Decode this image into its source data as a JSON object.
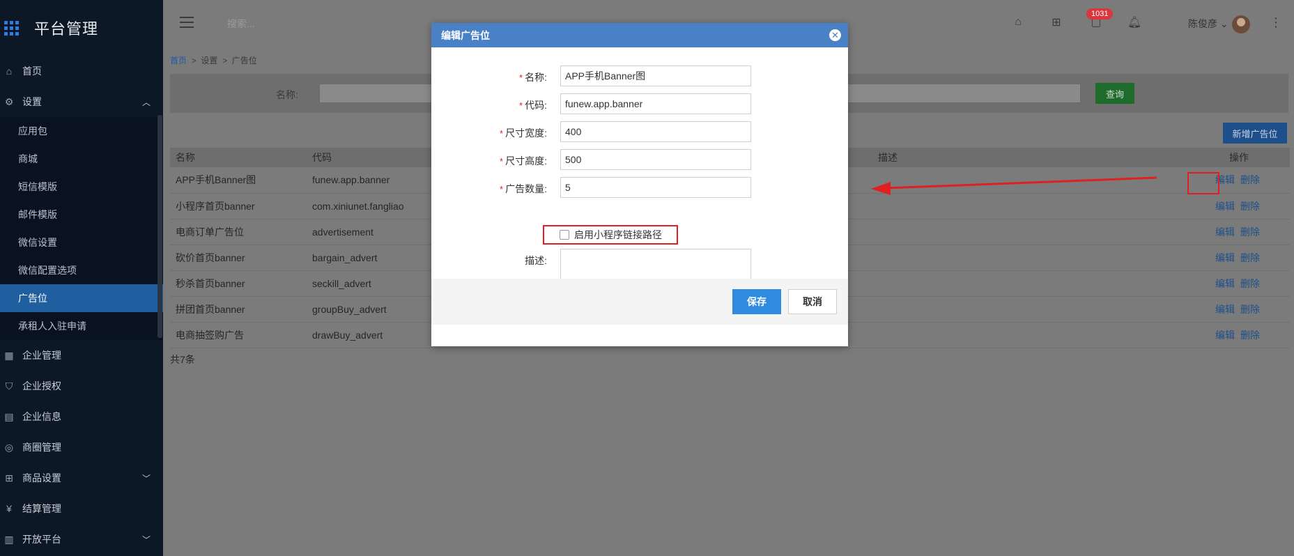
{
  "app": {
    "title": "平台管理"
  },
  "sidebar": {
    "items": [
      {
        "label": "首页",
        "icon": "home-icon"
      },
      {
        "label": "设置",
        "icon": "gear-icon",
        "expanded": true
      },
      {
        "label": "企业管理",
        "icon": "building-icon"
      },
      {
        "label": "企业授权",
        "icon": "shield-icon"
      },
      {
        "label": "企业信息",
        "icon": "info-icon"
      },
      {
        "label": "商圈管理",
        "icon": "compass-icon"
      },
      {
        "label": "商品设置",
        "icon": "grid-icon"
      },
      {
        "label": "结算管理",
        "icon": "yen-icon"
      },
      {
        "label": "开放平台",
        "icon": "platform-icon"
      }
    ],
    "settings_sub": [
      {
        "label": "应用包"
      },
      {
        "label": "商城"
      },
      {
        "label": "短信模版"
      },
      {
        "label": "邮件模版"
      },
      {
        "label": "微信设置"
      },
      {
        "label": "微信配置选项"
      },
      {
        "label": "广告位",
        "active": true
      },
      {
        "label": "承租人入驻申请"
      }
    ]
  },
  "topbar": {
    "search_placeholder": "搜索...",
    "badge_count": "1031",
    "user_name": "陈俊彦"
  },
  "breadcrumb": {
    "home": "首页",
    "level1": "设置",
    "level2": "广告位",
    "sep": ">"
  },
  "filter": {
    "name_label": "名称:",
    "query_button": "查询"
  },
  "add_button": "新增广告位",
  "table": {
    "headers": {
      "name": "名称",
      "code": "代码",
      "desc": "描述",
      "ops": "操作"
    },
    "rows": [
      {
        "name": "APP手机Banner图",
        "code": "funew.app.banner"
      },
      {
        "name": "小程序首页banner",
        "code": "com.xiniunet.fangliao"
      },
      {
        "name": "电商订单广告位",
        "code": "advertisement"
      },
      {
        "name": "砍价首页banner",
        "code": "bargain_advert"
      },
      {
        "name": "秒杀首页banner",
        "code": "seckill_advert"
      },
      {
        "name": "拼团首页banner",
        "code": "groupBuy_advert"
      },
      {
        "name": "电商抽签购广告",
        "code": "drawBuy_advert"
      }
    ],
    "edit_label": "编辑",
    "delete_label": "删除",
    "total": "共7条"
  },
  "modal": {
    "title": "编辑广告位",
    "fields": {
      "name_label": "名称:",
      "name_value": "APP手机Banner图",
      "code_label": "代码:",
      "code_value": "funew.app.banner",
      "width_label": "尺寸宽度:",
      "width_value": "400",
      "height_label": "尺寸高度:",
      "height_value": "500",
      "count_label": "广告数量:",
      "count_value": "5",
      "miniprogram_label": "启用小程序链接路径",
      "miniprogram_checked": false,
      "desc_label": "描述:",
      "desc_value": ""
    },
    "save_label": "保存",
    "cancel_label": "取消",
    "required_mark": "*"
  },
  "colors": {
    "sidebar_bg": "#0d1826",
    "active_item": "#1f5fa0",
    "modal_header": "#4a80c6",
    "save_button": "#2f8be0",
    "annotation_red": "#e02020",
    "overlay": "#7b7b7b"
  }
}
